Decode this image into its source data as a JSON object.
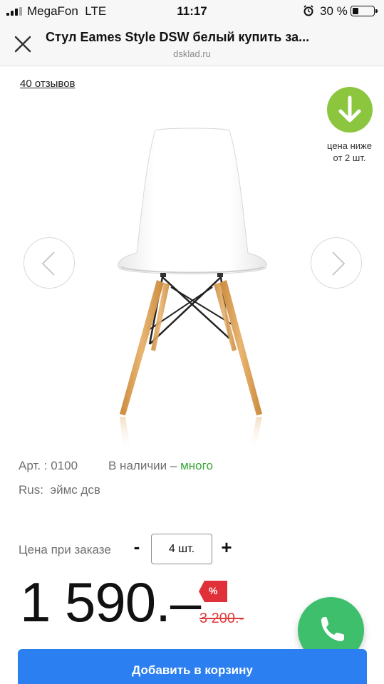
{
  "status_bar": {
    "carrier": "MegaFon",
    "network": "LTE",
    "time": "11:17",
    "battery_percent": "30 %",
    "battery_level": 0.3
  },
  "header": {
    "title": "Стул Eames Style DSW белый купить за...",
    "domain": "dsklad.ru"
  },
  "product": {
    "reviews_link": "40 отзывов",
    "badge_text_line1": "цена ниже",
    "badge_text_line2": "от 2 шт.",
    "article": "Арт. : 0100",
    "availability_label": "В наличии",
    "availability_dash": "–",
    "availability_value": "много",
    "rus_label": "Rus:",
    "rus_value": "эймс дсв"
  },
  "order": {
    "label": "Цена при заказе",
    "minus": "-",
    "quantity": "4 шт.",
    "plus": "+"
  },
  "price": {
    "current": "1 590.–",
    "discount_symbol": "%",
    "old": "3 200.-"
  },
  "actions": {
    "add_to_cart": "Добавить в корзину"
  },
  "colors": {
    "accent_green": "#8cc63f",
    "stock_green": "#3aa83a",
    "cart_blue": "#2b7ff0",
    "sale_red": "#e03c3c",
    "call_green": "#3dbf6c"
  },
  "icons": {
    "badge": "arrow-down-icon",
    "nav_prev": "chevron-left-icon",
    "nav_next": "chevron-right-icon",
    "close": "close-icon",
    "call": "phone-icon"
  }
}
